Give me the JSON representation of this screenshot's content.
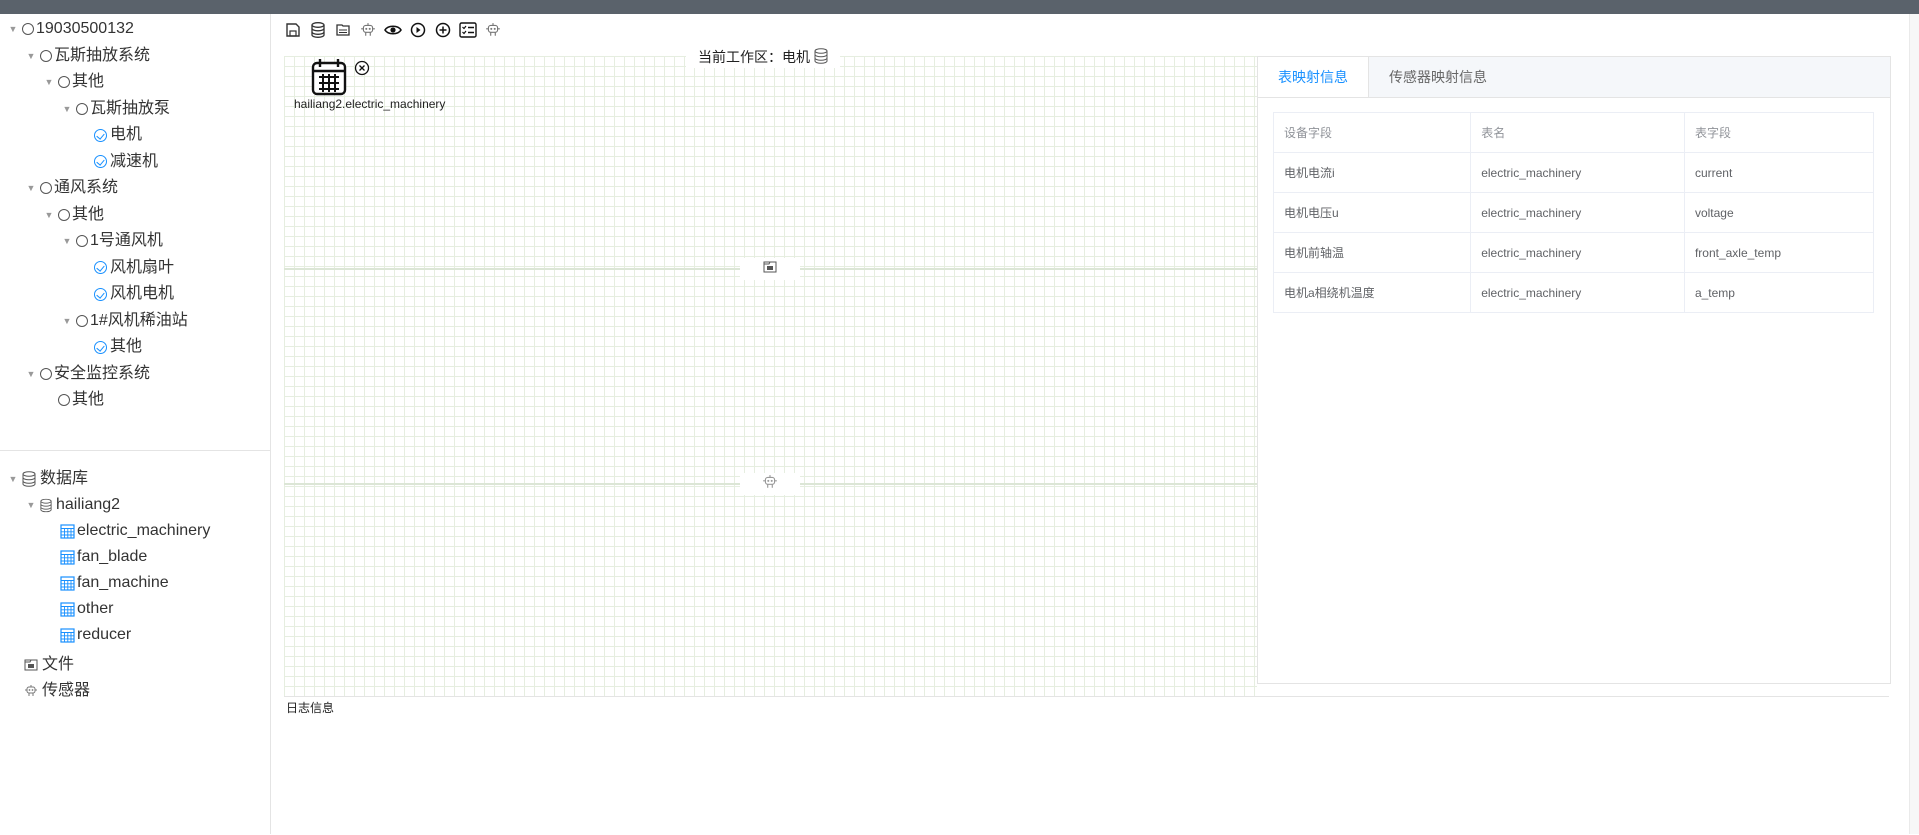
{
  "device_tree": [
    {
      "label": "19030500132",
      "arrow": true,
      "marker": "circle"
    },
    {
      "label": "瓦斯抽放系统",
      "arrow": true,
      "marker": "circle"
    },
    {
      "label": "其他",
      "arrow": true,
      "marker": "circle"
    },
    {
      "label": "瓦斯抽放泵",
      "arrow": true,
      "marker": "circle"
    },
    {
      "label": "电机",
      "arrow": false,
      "marker": "check"
    },
    {
      "label": "减速机",
      "arrow": false,
      "marker": "check"
    },
    {
      "label": "通风系统",
      "arrow": true,
      "marker": "circle"
    },
    {
      "label": "其他",
      "arrow": true,
      "marker": "circle"
    },
    {
      "label": "1号通风机",
      "arrow": true,
      "marker": "circle"
    },
    {
      "label": "风机扇叶",
      "arrow": false,
      "marker": "check"
    },
    {
      "label": "风机电机",
      "arrow": false,
      "marker": "check"
    },
    {
      "label": "1#风机稀油站",
      "arrow": true,
      "marker": "circle"
    },
    {
      "label": "其他",
      "arrow": false,
      "marker": "check"
    },
    {
      "label": "安全监控系统",
      "arrow": true,
      "marker": "circle"
    },
    {
      "label": "其他",
      "arrow": false,
      "marker": "circle"
    }
  ],
  "db_tree": {
    "root_label": "数据库",
    "db_label": "hailiang2",
    "tables": [
      "electric_machinery",
      "fan_blade",
      "fan_machine",
      "other",
      "reducer"
    ],
    "files_label": "文件",
    "sensors_label": "传感器"
  },
  "toolbar_icons": [
    "save-icon",
    "database-icon",
    "file-icon",
    "robot-icon",
    "eye-icon",
    "play-icon",
    "plus-circle-icon",
    "checklist-icon",
    "robot-outline-icon"
  ],
  "workspace": {
    "title": "当前工作区：电机",
    "node_label": "hailiang2.electric_machinery"
  },
  "mapping": {
    "tabs": [
      "表映射信息",
      "传感器映射信息"
    ],
    "active_tab": 0,
    "columns": [
      "设备字段",
      "表名",
      "表字段"
    ],
    "rows": [
      [
        "电机电流i",
        "electric_machinery",
        "current"
      ],
      [
        "电机电压u",
        "electric_machinery",
        "voltage"
      ],
      [
        "电机前轴温",
        "electric_machinery",
        "front_axle_temp"
      ],
      [
        "电机a相绕机温度",
        "electric_machinery",
        "a_temp"
      ]
    ]
  },
  "log": {
    "label": "日志信息"
  },
  "colors": {
    "accent": "#1890ff",
    "topbar": "#5a626b",
    "grid": "#e6eee0"
  }
}
